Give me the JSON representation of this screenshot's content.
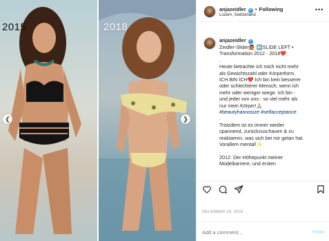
{
  "photos": {
    "left_year": "2015",
    "right_year": "2018"
  },
  "header": {
    "username": "anjazeidler",
    "follow_state": "Following",
    "location": "Luzern, Switzerland",
    "more_glyph": "•••"
  },
  "caption": {
    "username": "anjazeidler",
    "lines": [
      "Zeidler-Slider🙋🏽 ⬅️SLIDE LEFT •",
      "Transformation 2012 - 2018❤️",
      ".",
      "Heute betrachte ich mich nicht mehr",
      "als Gewichtszahl oder Körperform.",
      "ICH BIN ICH❤️  Ich bin kein besserer",
      "oder schlechterer Mensch, wenn ich",
      "mehr oder weniger wiege. Ich bin -",
      "und jeder von uns - so viel mehr als",
      "nur mein Körper!🙏🏼",
      "#beautyhasnosize #selfacceptance",
      ".",
      "Trotzdem ist es immer wieder",
      "spannend, zurückzuschauen & zu",
      "realisieren, was sich bei mir getan hat.",
      "Vorallem mental!✨",
      ".",
      "2012: Der Höhepunkt meiner",
      "Modelkarriere, und ersten"
    ],
    "hashtag_line_index": 10
  },
  "actions": {
    "like_icon": "heart-outline",
    "comment_icon": "speech-bubble",
    "share_icon": "paper-plane",
    "save_icon": "bookmark"
  },
  "date": "DECEMBER 18, 2018",
  "comment": {
    "placeholder": "Add a comment...",
    "post_label": "Post"
  },
  "colors": {
    "link": "#00376b",
    "verified": "#3897f0",
    "post_disabled": "#b2dffc",
    "muted": "#8e8e8e"
  }
}
